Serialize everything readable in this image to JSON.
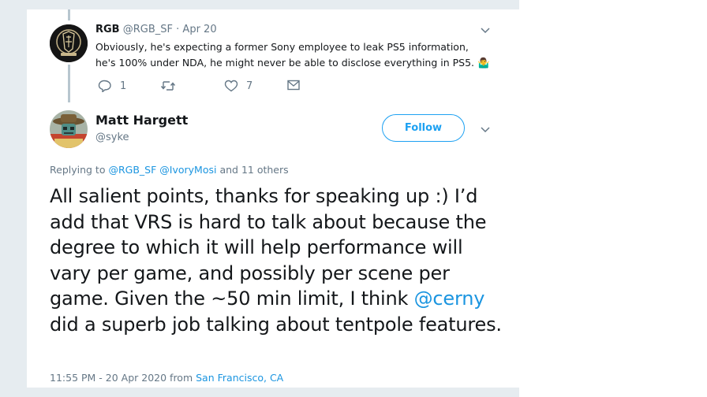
{
  "parent_tweet": {
    "display_name": "RGB",
    "handle": "@RGB_SF",
    "separator": "·",
    "date": "Apr 20",
    "text": "Obviously, he's expecting a former Sony employee to leak PS5 information, he's 100% under NDA, he might never be able to disclose everything in PS5.",
    "emoji": "🤷‍♂️",
    "reply_count": "1",
    "retweet_count": "",
    "like_count": "7"
  },
  "main_tweet": {
    "display_name": "Matt Hargett",
    "handle": "@syke",
    "follow_label": "Follow",
    "replying_prefix": "Replying to",
    "replying_user1": "@RGB_SF",
    "replying_user2": "@IvoryMosi",
    "replying_suffix": "and 11 others",
    "text_before": "All salient points, thanks for speaking up :) I’d add that VRS is hard to talk about because the degree to which it will help performance will vary per game, and possibly per scene per game. Given the ~50 min limit, I think ",
    "mention": "@cerny",
    "text_after": " did a superb job talking about tentpole features.",
    "time": "11:55 PM - 20 Apr 2020 from",
    "location": "San Francisco, CA"
  },
  "icons": {
    "reply": "reply-icon",
    "retweet": "retweet-icon",
    "like": "heart-icon",
    "message": "envelope-icon",
    "chevron": "chevron-down-icon"
  },
  "colors": {
    "link": "#1b95e0",
    "follow": "#1da1f2",
    "muted": "#657786",
    "text": "#14171a"
  }
}
